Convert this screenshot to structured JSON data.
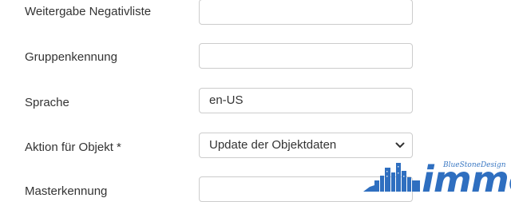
{
  "form": {
    "rows": [
      {
        "label": "Weitergabe Negativliste",
        "value": ""
      },
      {
        "label": "Gruppenkennung",
        "value": ""
      },
      {
        "label": "Sprache",
        "value": "en-US"
      },
      {
        "label": "Aktion für Objekt *",
        "value": "Update der Objektdaten"
      },
      {
        "label": "Masterkennung",
        "value": ""
      }
    ]
  },
  "watermark": {
    "small_text": "BlueStoneDesign",
    "big_text": "immo",
    "color": "#2f6fc0"
  },
  "icons": {
    "select_chevron": "chevron-down-icon"
  }
}
